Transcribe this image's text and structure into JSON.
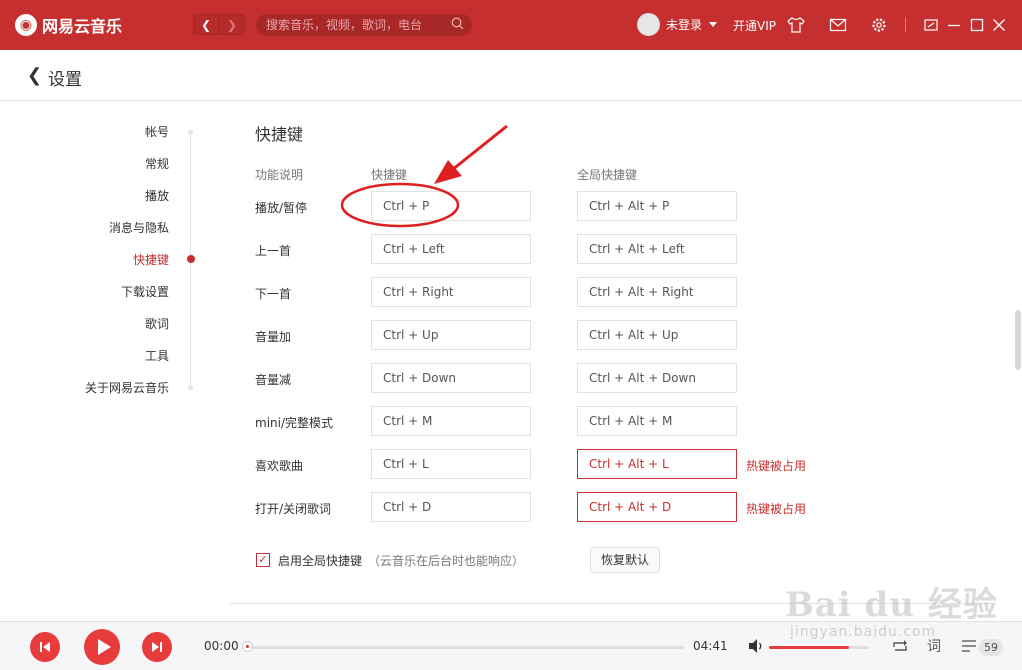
{
  "app": {
    "name": "网易云音乐",
    "search_placeholder": "搜索音乐，视频，歌词，电台",
    "user_label": "未登录",
    "vip_label": "开通VIP"
  },
  "page": {
    "title": "设置",
    "section_title": "快捷键"
  },
  "sidebar": {
    "items": [
      {
        "label": "帐号"
      },
      {
        "label": "常规"
      },
      {
        "label": "播放"
      },
      {
        "label": "消息与隐私"
      },
      {
        "label": "快捷键",
        "active": true
      },
      {
        "label": "下载设置"
      },
      {
        "label": "歌词"
      },
      {
        "label": "工具"
      },
      {
        "label": "关于网易云音乐"
      }
    ]
  },
  "shortcuts": {
    "headers": {
      "function": "功能说明",
      "local": "快捷键",
      "global": "全局快捷键"
    },
    "rows": [
      {
        "label": "播放/暂停",
        "local": "Ctrl + P",
        "global": "Ctrl + Alt + P"
      },
      {
        "label": "上一首",
        "local": "Ctrl + Left",
        "global": "Ctrl + Alt + Left"
      },
      {
        "label": "下一首",
        "local": "Ctrl + Right",
        "global": "Ctrl + Alt + Right"
      },
      {
        "label": "音量加",
        "local": "Ctrl + Up",
        "global": "Ctrl + Alt + Up"
      },
      {
        "label": "音量减",
        "local": "Ctrl + Down",
        "global": "Ctrl + Alt + Down"
      },
      {
        "label": "mini/完整模式",
        "local": "Ctrl + M",
        "global": "Ctrl + Alt + M"
      },
      {
        "label": "喜欢歌曲",
        "local": "Ctrl + L",
        "global": "Ctrl + Alt + L",
        "conflict": "热键被占用"
      },
      {
        "label": "打开/关闭歌词",
        "local": "Ctrl + D",
        "global": "Ctrl + Alt + D",
        "conflict": "热键被占用"
      }
    ],
    "enable_global_label": "启用全局快捷键",
    "enable_global_hint": "（云音乐在后台时也能响应）",
    "enable_global_checked": true,
    "reset_label": "恢复默认"
  },
  "player": {
    "current_time": "00:00",
    "total_time": "04:41",
    "progress": 0.0,
    "volume": 0.8,
    "lyric_button": "词",
    "playlist_count": "59"
  },
  "icons": {
    "accent": "#c62f2f",
    "play_button": "#e83c3c"
  },
  "watermark": {
    "text": "Bai du 经验",
    "url": "jingyan.baidu.com"
  }
}
